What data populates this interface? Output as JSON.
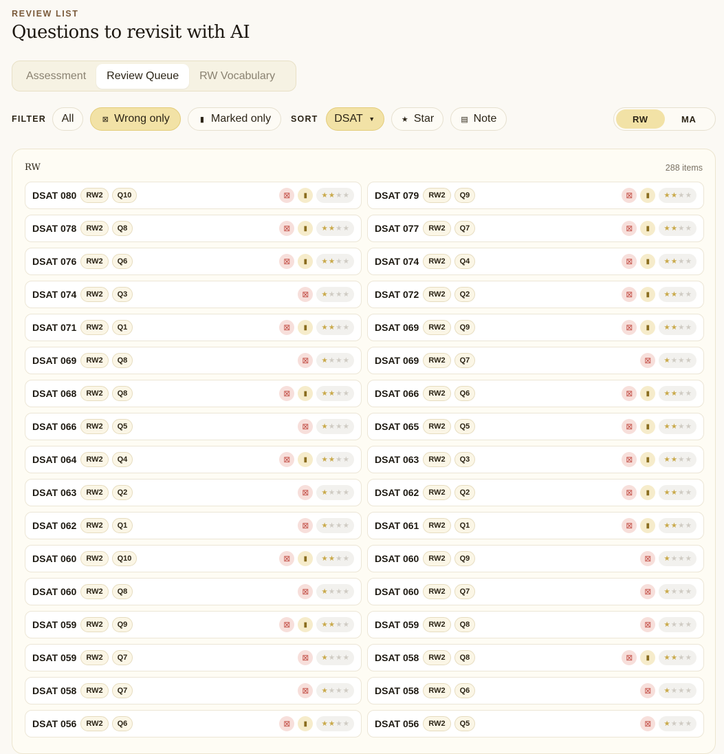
{
  "header": {
    "eyebrow": "REVIEW LIST",
    "title": "Questions to revisit with AI"
  },
  "tabs": [
    {
      "label": "Assessment",
      "active": false
    },
    {
      "label": "Review Queue",
      "active": true
    },
    {
      "label": "RW Vocabulary",
      "active": false
    }
  ],
  "filter": {
    "label": "FILTER",
    "all": "All",
    "wrong_only": "Wrong only",
    "marked_only": "Marked only",
    "active": "wrong_only"
  },
  "sort": {
    "label": "SORT",
    "dsat": "DSAT",
    "star": "Star",
    "note": "Note",
    "active": "dsat"
  },
  "subject_toggle": {
    "rw": "RW",
    "ma": "MA",
    "active": "rw"
  },
  "icons": {
    "wrong": "x-square-icon",
    "mark": "bookmark-icon",
    "star": "star-icon",
    "note": "note-icon",
    "dropdown": "caret-down-icon"
  },
  "colors": {
    "accent": "#f2e2a6",
    "wrong": "#c4524a",
    "star_filled": "#c9a94a",
    "background": "#fbf9f4"
  },
  "panel": {
    "title": "RW",
    "count": "288 items",
    "items": [
      {
        "name": "DSAT 080",
        "section": "RW2",
        "question": "Q10",
        "wrong": true,
        "marked": true,
        "stars": 2
      },
      {
        "name": "DSAT 079",
        "section": "RW2",
        "question": "Q9",
        "wrong": true,
        "marked": true,
        "stars": 2
      },
      {
        "name": "DSAT 078",
        "section": "RW2",
        "question": "Q8",
        "wrong": true,
        "marked": true,
        "stars": 2
      },
      {
        "name": "DSAT 077",
        "section": "RW2",
        "question": "Q7",
        "wrong": true,
        "marked": true,
        "stars": 2
      },
      {
        "name": "DSAT 076",
        "section": "RW2",
        "question": "Q6",
        "wrong": true,
        "marked": true,
        "stars": 2
      },
      {
        "name": "DSAT 074",
        "section": "RW2",
        "question": "Q4",
        "wrong": true,
        "marked": true,
        "stars": 2
      },
      {
        "name": "DSAT 074",
        "section": "RW2",
        "question": "Q3",
        "wrong": true,
        "marked": false,
        "stars": 1
      },
      {
        "name": "DSAT 072",
        "section": "RW2",
        "question": "Q2",
        "wrong": true,
        "marked": true,
        "stars": 2
      },
      {
        "name": "DSAT 071",
        "section": "RW2",
        "question": "Q1",
        "wrong": true,
        "marked": true,
        "stars": 2
      },
      {
        "name": "DSAT 069",
        "section": "RW2",
        "question": "Q9",
        "wrong": true,
        "marked": true,
        "stars": 2
      },
      {
        "name": "DSAT 069",
        "section": "RW2",
        "question": "Q8",
        "wrong": true,
        "marked": false,
        "stars": 1
      },
      {
        "name": "DSAT 069",
        "section": "RW2",
        "question": "Q7",
        "wrong": true,
        "marked": false,
        "stars": 1
      },
      {
        "name": "DSAT 068",
        "section": "RW2",
        "question": "Q8",
        "wrong": true,
        "marked": true,
        "stars": 2
      },
      {
        "name": "DSAT 066",
        "section": "RW2",
        "question": "Q6",
        "wrong": true,
        "marked": true,
        "stars": 2
      },
      {
        "name": "DSAT 066",
        "section": "RW2",
        "question": "Q5",
        "wrong": true,
        "marked": false,
        "stars": 1
      },
      {
        "name": "DSAT 065",
        "section": "RW2",
        "question": "Q5",
        "wrong": true,
        "marked": true,
        "stars": 2
      },
      {
        "name": "DSAT 064",
        "section": "RW2",
        "question": "Q4",
        "wrong": true,
        "marked": true,
        "stars": 2
      },
      {
        "name": "DSAT 063",
        "section": "RW2",
        "question": "Q3",
        "wrong": true,
        "marked": true,
        "stars": 2
      },
      {
        "name": "DSAT 063",
        "section": "RW2",
        "question": "Q2",
        "wrong": true,
        "marked": false,
        "stars": 1
      },
      {
        "name": "DSAT 062",
        "section": "RW2",
        "question": "Q2",
        "wrong": true,
        "marked": true,
        "stars": 2
      },
      {
        "name": "DSAT 062",
        "section": "RW2",
        "question": "Q1",
        "wrong": true,
        "marked": false,
        "stars": 1
      },
      {
        "name": "DSAT 061",
        "section": "RW2",
        "question": "Q1",
        "wrong": true,
        "marked": true,
        "stars": 2
      },
      {
        "name": "DSAT 060",
        "section": "RW2",
        "question": "Q10",
        "wrong": true,
        "marked": true,
        "stars": 2
      },
      {
        "name": "DSAT 060",
        "section": "RW2",
        "question": "Q9",
        "wrong": true,
        "marked": false,
        "stars": 1
      },
      {
        "name": "DSAT 060",
        "section": "RW2",
        "question": "Q8",
        "wrong": true,
        "marked": false,
        "stars": 1
      },
      {
        "name": "DSAT 060",
        "section": "RW2",
        "question": "Q7",
        "wrong": true,
        "marked": false,
        "stars": 1
      },
      {
        "name": "DSAT 059",
        "section": "RW2",
        "question": "Q9",
        "wrong": true,
        "marked": true,
        "stars": 2
      },
      {
        "name": "DSAT 059",
        "section": "RW2",
        "question": "Q8",
        "wrong": true,
        "marked": false,
        "stars": 1
      },
      {
        "name": "DSAT 059",
        "section": "RW2",
        "question": "Q7",
        "wrong": true,
        "marked": false,
        "stars": 1
      },
      {
        "name": "DSAT 058",
        "section": "RW2",
        "question": "Q8",
        "wrong": true,
        "marked": true,
        "stars": 2
      },
      {
        "name": "DSAT 058",
        "section": "RW2",
        "question": "Q7",
        "wrong": true,
        "marked": false,
        "stars": 1
      },
      {
        "name": "DSAT 058",
        "section": "RW2",
        "question": "Q6",
        "wrong": true,
        "marked": false,
        "stars": 1
      },
      {
        "name": "DSAT 056",
        "section": "RW2",
        "question": "Q6",
        "wrong": true,
        "marked": true,
        "stars": 2
      },
      {
        "name": "DSAT 056",
        "section": "RW2",
        "question": "Q5",
        "wrong": true,
        "marked": false,
        "stars": 1
      }
    ]
  }
}
